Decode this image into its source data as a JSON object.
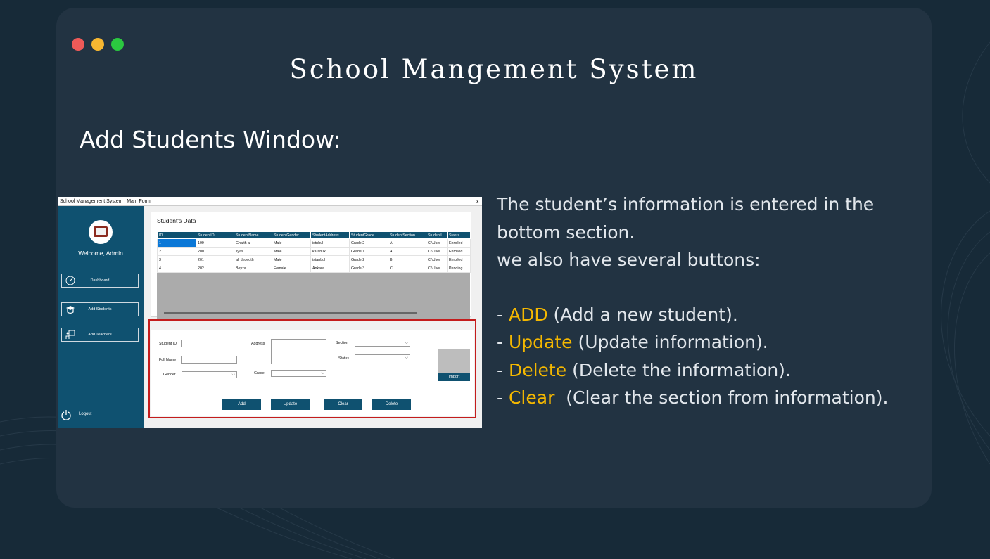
{
  "slide": {
    "title": "School Mangement System",
    "subtitle": "Add Students Window:",
    "description": {
      "line1": "The student’s information is entered in the bottom section.",
      "line2": "we also have several buttons:",
      "bullets": [
        {
          "prefix": "- ",
          "keyword": "ADD",
          "text": " (Add a new student)."
        },
        {
          "prefix": "- ",
          "keyword": "Update",
          "text": " (Update information)."
        },
        {
          "prefix": "- ",
          "keyword": "Delete",
          "text": " (Delete the information)."
        },
        {
          "prefix": "- ",
          "keyword": "Clear",
          "text": "  (Clear the section from information)."
        }
      ]
    }
  },
  "colors": {
    "accent": "#f5b800",
    "card": "#223342",
    "background": "#172a38",
    "app_primary": "#0f5170",
    "highlight_border": "#c41c1c"
  },
  "app": {
    "window_title": "School Management System | Main Form",
    "close_label": "x",
    "welcome": "Welcome, Admin",
    "nav": {
      "dashboard": "Dashboard",
      "add_students": "Add Students",
      "add_teachers": "Add Teachers",
      "logout": "Logout"
    },
    "icons": {
      "logo": "book-logo-icon",
      "dashboard": "gauge-icon",
      "students": "graduate-icon",
      "teachers": "teacher-board-icon",
      "logout": "power-icon"
    },
    "data_heading": "Student's Data",
    "table": {
      "columns": [
        "ID",
        "StudentID",
        "StudentName",
        "StudentGender",
        "StudentAddress",
        "StudentGrade",
        "StudentSection",
        "StudentI",
        "Status"
      ],
      "rows": [
        [
          "1",
          "199",
          "Ghaith a",
          "Male",
          "istnbul",
          "Grade 2",
          "A",
          "C:\\User",
          "Enrolled"
        ],
        [
          "2",
          "200",
          "ilyas",
          "Male",
          "karabuk",
          "Grade 1",
          "A",
          "C:\\User",
          "Enrolled"
        ],
        [
          "3",
          "201",
          "ali dzdeoth",
          "Male",
          "istanbul",
          "Grade 2",
          "B",
          "C:\\User",
          "Enrolled"
        ],
        [
          "4",
          "202",
          "Beyza",
          "Female",
          "Ankara",
          "Grade 3",
          "C",
          "C:\\User",
          "Pending"
        ]
      ]
    },
    "form": {
      "student_id_label": "Student ID",
      "full_name_label": "Full Name",
      "gender_label": "Gender",
      "address_label": "Address",
      "grade_label": "Grade",
      "section_label": "Section",
      "status_label": "Status",
      "import_label": "Import"
    },
    "buttons": {
      "add": "Add",
      "update": "Update",
      "clear": "Clear",
      "delete": "Delete"
    }
  }
}
